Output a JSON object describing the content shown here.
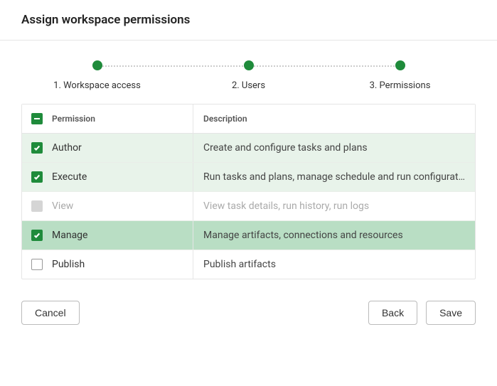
{
  "header": {
    "title": "Assign workspace permissions"
  },
  "stepper": {
    "steps": [
      {
        "label": "1. Workspace access"
      },
      {
        "label": "2. Users"
      },
      {
        "label": "3. Permissions"
      }
    ]
  },
  "table": {
    "headers": {
      "permission": "Permission",
      "description": "Description"
    },
    "rows": [
      {
        "permission": "Author",
        "description": "Create and configure tasks and plans",
        "checked": true,
        "disabled": false,
        "selected": false
      },
      {
        "permission": "Execute",
        "description": "Run tasks and plans, manage schedule and run configuration, a…",
        "checked": true,
        "disabled": false,
        "selected": false
      },
      {
        "permission": "View",
        "description": "View task details, run history, run logs",
        "checked": false,
        "disabled": true,
        "selected": false
      },
      {
        "permission": "Manage",
        "description": "Manage artifacts, connections and resources",
        "checked": true,
        "disabled": false,
        "selected": true
      },
      {
        "permission": "Publish",
        "description": "Publish artifacts",
        "checked": false,
        "disabled": false,
        "selected": false
      }
    ]
  },
  "footer": {
    "cancel": "Cancel",
    "back": "Back",
    "save": "Save"
  }
}
